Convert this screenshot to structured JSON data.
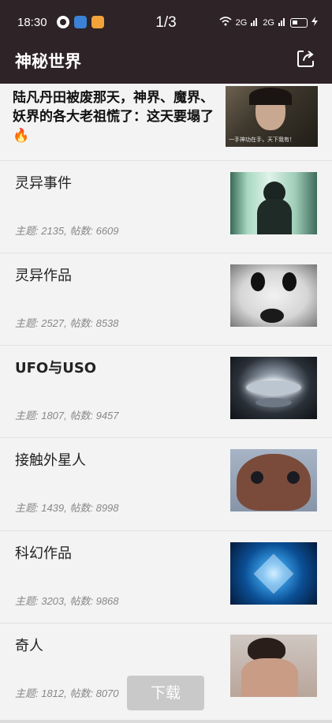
{
  "status": {
    "time": "18:30",
    "page_indicator": "1/3",
    "signal_1": "2G",
    "signal_2": "2G"
  },
  "app_bar": {
    "title": "神秘世界",
    "share_icon": "share-icon"
  },
  "featured": {
    "title": "陆凡丹田被废那天，神界、魔界、妖界的各大老祖慌了：这天要塌了🔥",
    "thumb_caption": "一手神功在手，天下我有！"
  },
  "categories": [
    {
      "title": "灵异事件",
      "meta": "主题: 2135, 帖数: 6609",
      "thumb": "ghost-image"
    },
    {
      "title": "灵异作品",
      "meta": "主题: 2527, 帖数: 8538",
      "thumb": "mask-image"
    },
    {
      "title": "UFO与USO",
      "meta": "主题: 1807, 帖数: 9457",
      "thumb": "ufo-image"
    },
    {
      "title": "接触外星人",
      "meta": "主题: 1439, 帖数: 8998",
      "thumb": "alien-image"
    },
    {
      "title": "科幻作品",
      "meta": "主题: 3203, 帖数: 9868",
      "thumb": "star-image"
    },
    {
      "title": "奇人",
      "meta": "主题: 1812, 帖数: 8070",
      "thumb": "person-image"
    }
  ],
  "download_button": "下载",
  "colors": {
    "app_bar": "#2e2327",
    "background": "#f3f3f3",
    "meta_text": "#888888"
  }
}
